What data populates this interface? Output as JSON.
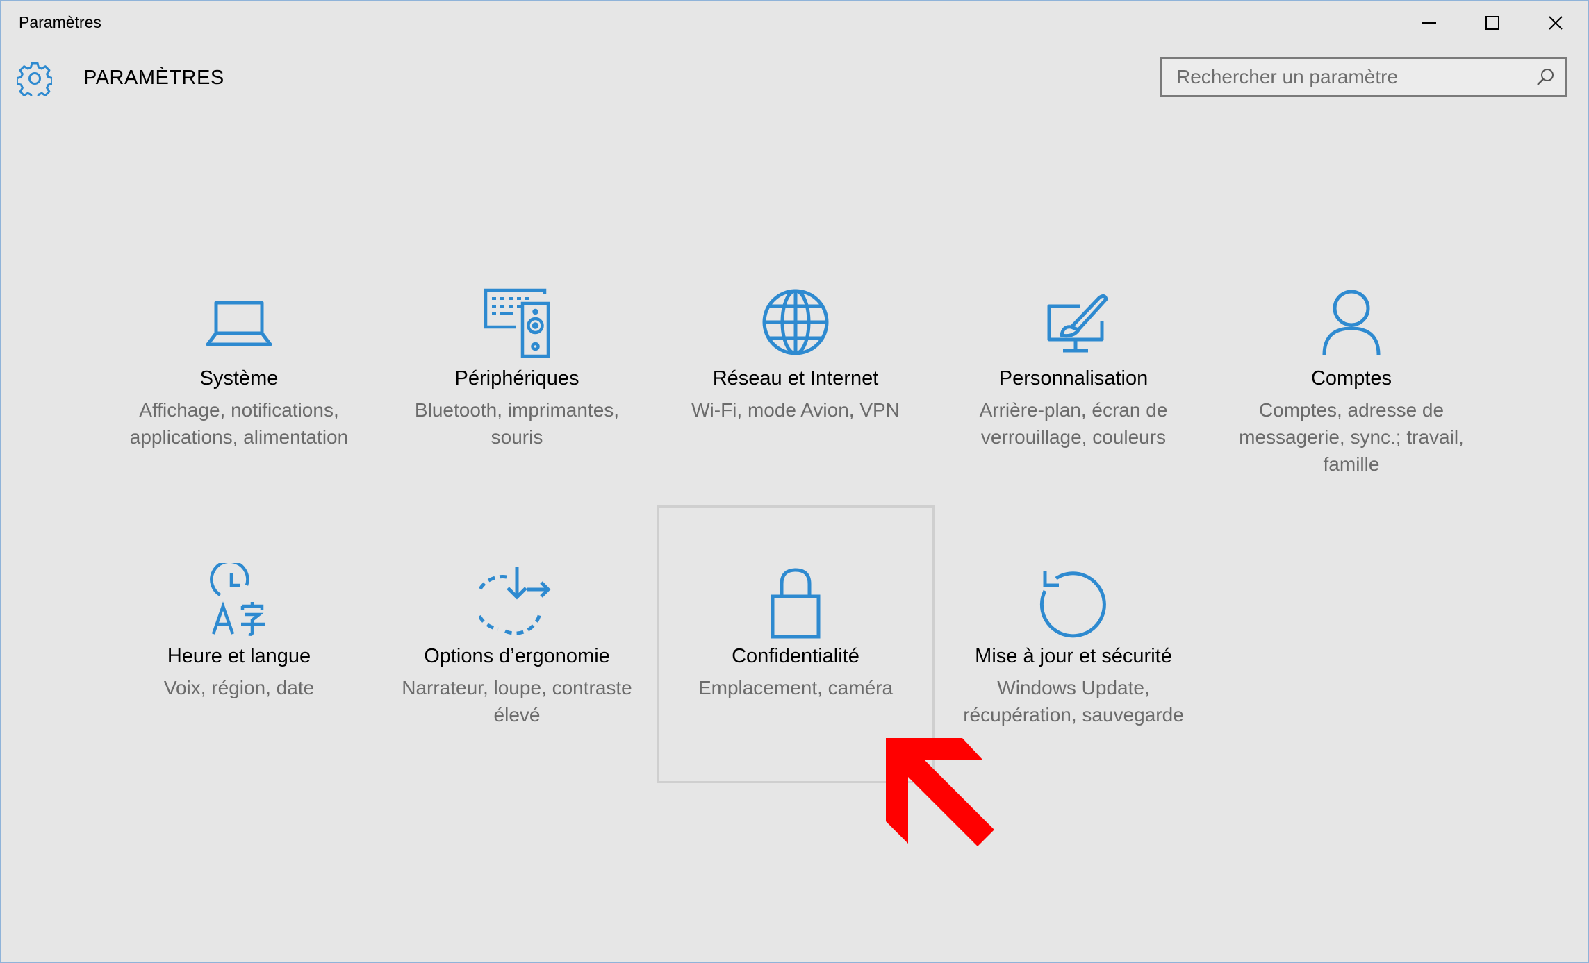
{
  "window": {
    "title": "Paramètres",
    "accent_color": "#2e8ad0"
  },
  "header": {
    "app_title": "PARAMÈTRES",
    "search_placeholder": "Rechercher un paramètre"
  },
  "tiles": [
    {
      "id": "systeme",
      "icon": "laptop-icon",
      "name": "Système",
      "desc": "Affichage, notifications, applications, alimentation"
    },
    {
      "id": "peripheriques",
      "icon": "devices-icon",
      "name": "Périphériques",
      "desc": "Bluetooth, imprimantes, souris"
    },
    {
      "id": "reseau",
      "icon": "globe-icon",
      "name": "Réseau et Internet",
      "desc": "Wi-Fi, mode Avion, VPN"
    },
    {
      "id": "personnalisation",
      "icon": "paint-monitor-icon",
      "name": "Personnalisation",
      "desc": "Arrière-plan, écran de verrouillage, couleurs"
    },
    {
      "id": "comptes",
      "icon": "person-icon",
      "name": "Comptes",
      "desc": "Comptes, adresse de messagerie, sync.; travail, famille"
    },
    {
      "id": "heure",
      "icon": "time-language-icon",
      "name": "Heure et langue",
      "desc": "Voix, région, date"
    },
    {
      "id": "ergonomie",
      "icon": "ease-of-access-icon",
      "name": "Options d’ergonomie",
      "desc": "Narrateur, loupe, contraste élevé"
    },
    {
      "id": "confidentialite",
      "icon": "lock-icon",
      "name": "Confidentialité",
      "desc": "Emplacement, caméra",
      "selected": true
    },
    {
      "id": "miseajour",
      "icon": "update-icon",
      "name": "Mise à jour et sécurité",
      "desc": "Windows Update, récupération, sauvegarde"
    }
  ],
  "annotation": {
    "icon": "red-arrow-icon",
    "color": "#ff0000"
  }
}
